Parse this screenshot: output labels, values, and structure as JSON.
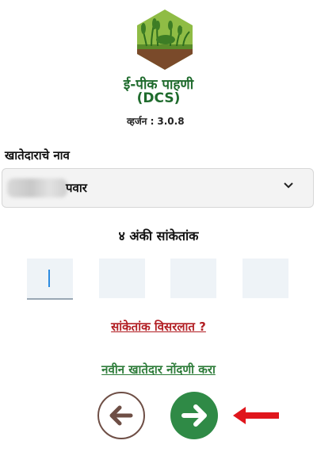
{
  "app": {
    "title": "ई-पीक पाहणी",
    "subtitle": "(DCS)",
    "version_label": "व्हर्जन :",
    "version_value": "3.0.8"
  },
  "account": {
    "label": "खातेदाराचे नाव",
    "selected_value": "पवार"
  },
  "pin": {
    "label": "४ अंकी सांकेतांक",
    "digits": [
      "",
      "",
      "",
      ""
    ]
  },
  "links": {
    "forgot": "सांकेतांक विसरलात ?",
    "register": "नवीन खातेदार नोंदणी करा"
  },
  "icons": {
    "logo": "crop-field-logo-icon",
    "chevron": "chevron-down-icon",
    "back": "arrow-left-icon",
    "next": "arrow-right-icon",
    "pointer": "red-arrow-pointer-icon"
  },
  "colors": {
    "brand_green": "#1f6b2d",
    "link_red": "#b21f24",
    "next_button": "#2f8a46",
    "back_button_border": "#6e4e45",
    "pointer_red": "#e0161c"
  }
}
